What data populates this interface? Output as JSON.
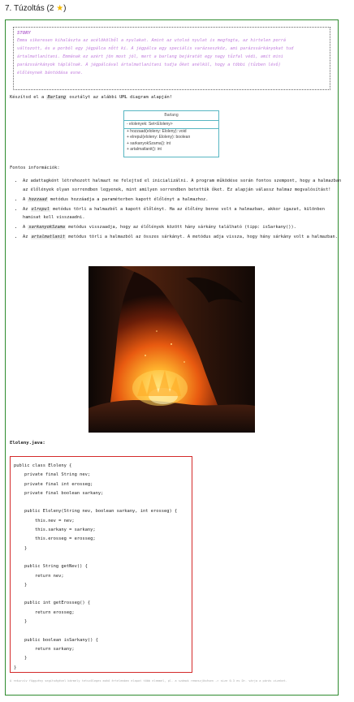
{
  "header": {
    "title": "7. Túzoltás (2",
    "star": "★",
    "close": ")"
  },
  "story": {
    "heading": "STORY",
    "lines": [
      "Emma sikeresen kihalászta az acélökölből a nyulakat. Amint az utolsó nyulat is megfogta, az hirtelen porrá",
      "változott, és a porból egy jégpálca nőtt ki. A jégpálca egy speciális varázseszköz, ami parázssárkányokat tud",
      "ártalmatlanítani. Emmának ez azért jön most jól, mert a barlang bejáratát egy nagy tűzfal védi, amit mini",
      "parázssárkányok táplálnak. A jégpálcával ártalmatlanítani tudja őket anélkül, hogy a többi (tűzben lévő)",
      "élőlénynek bántódása esne."
    ]
  },
  "intro": {
    "before": "Készítsd el a ",
    "code": "Barlang",
    "after": " osztályt az alábbi UML diagram alapján!"
  },
  "uml": {
    "class_name": "Barlang",
    "attribute": "- elolenyek: Set<Eloleny>",
    "operations": [
      "+ hozzaad(eloleny: Eloleny): void",
      "+ elrepul(eloleny: Eloleny): boolean",
      "+ sarkanyokSzama(): int",
      "+ artalmatlanit(): int"
    ]
  },
  "fontos": "Fontos információk:",
  "bullets": [
    {
      "parts": [
        {
          "t": "Az adattagként létrehozott halmazt ne felejtsd el inicializálni. A program működése során fontos szempont, hogy a halmazban az élőlények olyan sorrendben legyenek, mint amilyen sorrendben betettük őket. Ez alapján válassz halmaz megvalósítást!"
        }
      ]
    },
    {
      "parts": [
        {
          "t": "A "
        },
        {
          "c": "hozzaad"
        },
        {
          "t": " metódus hozzáadja a paraméterben kapott élőlényt a halmazhoz."
        }
      ]
    },
    {
      "parts": [
        {
          "t": "Az "
        },
        {
          "c": "elrepul"
        },
        {
          "t": " metódus törli a halmazból a kapott élőlényt. Ha az élőlény benne volt a halmazban, akkor igazat, különben hamisat kell visszaadni."
        }
      ]
    },
    {
      "parts": [
        {
          "t": "A "
        },
        {
          "c": "sarkanyokSzama"
        },
        {
          "t": " metódus visszaadja, hogy az élőlények között hány sárkány található (tipp: isSarkany())."
        }
      ]
    },
    {
      "parts": [
        {
          "t": "Az "
        },
        {
          "c": "artalmatlanit"
        },
        {
          "t": " metódus törli a halmazból az összes sárkányt. A metódus adja vissza, hogy hány sárkány volt a halmazban."
        }
      ]
    }
  ],
  "code_label": "Eloleny.java:",
  "code": [
    "public class Eloleny {",
    "    private final String nev;",
    "    private final int erosseg;",
    "    private final boolean sarkany;",
    "",
    "    public Eloleny(String nev, boolean sarkany, int erosseg) {",
    "        this.nev = nev;",
    "        this.sarkany = sarkany;",
    "        this.erosseg = erosseg;",
    "    }",
    "",
    "    public String getNev() {",
    "        return nev;",
    "    }",
    "",
    "    public int getErosseg() {",
    "        return erosseg;",
    "    }",
    "",
    "    public boolean isSarkany() {",
    "        return sarkany;",
    "    }",
    "}"
  ],
  "footnote": "A rekurzív függvény segítségével bármely tetszőleges mohó értelemben elapot több elemmel, pl. a számok remeszjövésen -> size 0.3 es Dr. várja a párás vizeket."
}
